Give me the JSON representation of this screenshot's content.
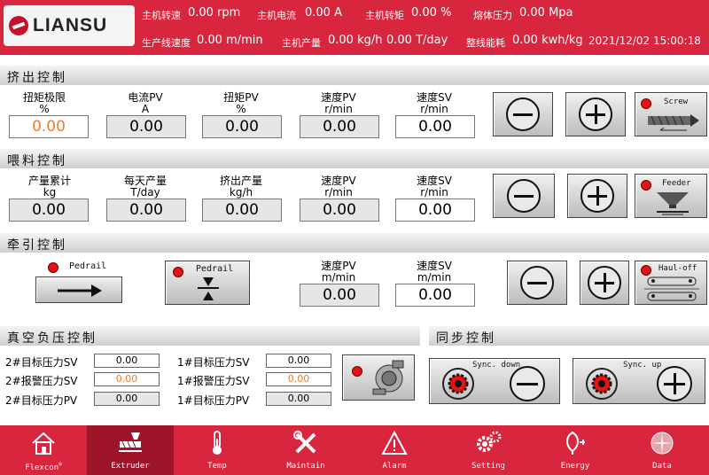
{
  "brand": "LIANSU",
  "header": {
    "screw_speed": {
      "label": "主机转速",
      "value": "0.00 rpm"
    },
    "current": {
      "label": "主机电流",
      "value": "0.00 A"
    },
    "torque": {
      "label": "主机转矩",
      "value": "0.00 %"
    },
    "melt_pressure": {
      "label": "熔体压力",
      "value": "0.00 Mpa"
    },
    "line_speed": {
      "label": "生产线速度",
      "value": "0.00 m/min"
    },
    "output": {
      "label": "主机产量",
      "value": "0.00 kg/h",
      "value2": "0.00 T/day"
    },
    "energy": {
      "label": "整线能耗",
      "value": "0.00 kwh/kg"
    },
    "datetime": "2021/12/02 15:00:18"
  },
  "extrusion": {
    "title": "挤出控制",
    "fields": [
      {
        "label": "扭矩极限",
        "unit": "%",
        "value": "0.00"
      },
      {
        "label": "电流PV",
        "unit": "A",
        "value": "0.00"
      },
      {
        "label": "扭矩PV",
        "unit": "%",
        "value": "0.00"
      },
      {
        "label": "速度PV",
        "unit": "r/min",
        "value": "0.00"
      },
      {
        "label": "速度SV",
        "unit": "r/min",
        "value": "0.00"
      }
    ],
    "device": "Screw"
  },
  "feeding": {
    "title": "喂料控制",
    "fields": [
      {
        "label": "产量累计",
        "unit": "kg",
        "value": "0.00"
      },
      {
        "label": "每天产量",
        "unit": "T/day",
        "value": "0.00"
      },
      {
        "label": "挤出产量",
        "unit": "kg/h",
        "value": "0.00"
      },
      {
        "label": "速度PV",
        "unit": "r/min",
        "value": "0.00"
      },
      {
        "label": "速度SV",
        "unit": "r/min",
        "value": "0.00"
      }
    ],
    "device": "Feeder"
  },
  "hauloff": {
    "title": "牵引控制",
    "pedrail1": "Pedrail",
    "pedrail2": "Pedrail",
    "fields": [
      {
        "label": "速度PV",
        "unit": "m/min",
        "value": "0.00"
      },
      {
        "label": "速度SV",
        "unit": "m/min",
        "value": "0.00"
      }
    ],
    "device": "Haul-off"
  },
  "vacuum": {
    "title": "真空负压控制",
    "left": [
      {
        "label": "2#目标压力SV",
        "value": "0.00"
      },
      {
        "label": "2#报警压力SV",
        "value": "0.00"
      },
      {
        "label": "2#目标压力PV",
        "value": "0.00"
      }
    ],
    "right": [
      {
        "label": "1#目标压力SV",
        "value": "0.00"
      },
      {
        "label": "1#报警压力SV",
        "value": "0.00"
      },
      {
        "label": "1#目标压力PV",
        "value": "0.00"
      }
    ]
  },
  "sync": {
    "title": "同步控制",
    "down": "Sync. down",
    "up": "Sync. up"
  },
  "nav": [
    "Flexcon",
    "Extruder",
    "Temp",
    "Maintain",
    "Alarm",
    "Setting",
    "Energy",
    "Data"
  ],
  "nav_trademark": "®",
  "colors": {
    "header": "#d9263f",
    "nav_active": "#9e1428",
    "alarm_led": "#e21414",
    "warn_value": "#f07b2a"
  }
}
